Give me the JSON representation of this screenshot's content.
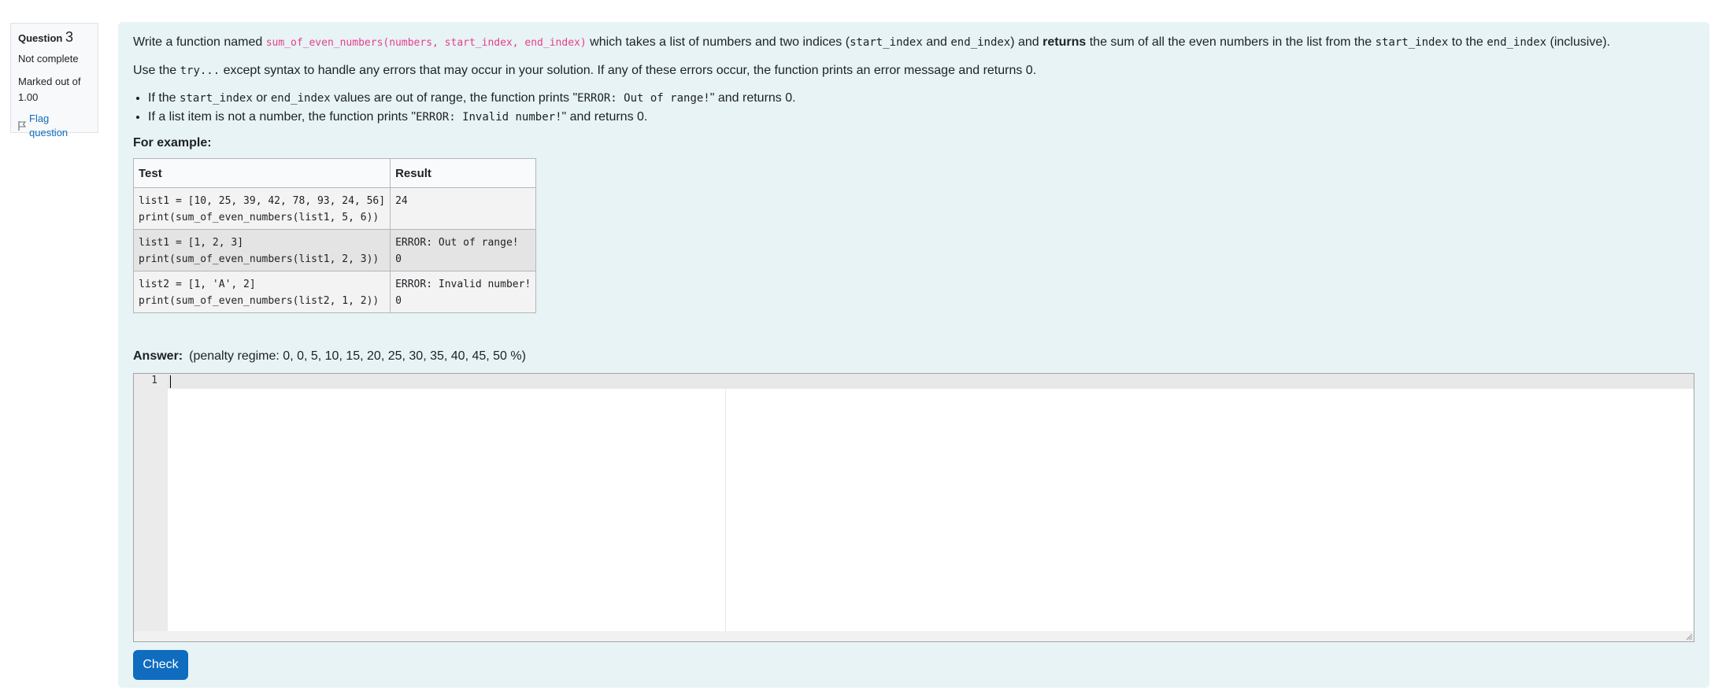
{
  "question": {
    "label": "Question",
    "number": "3",
    "state": "Not complete",
    "grade_line1": "Marked out of",
    "grade_line2": "1.00",
    "flag_label": "Flag question"
  },
  "content": {
    "intro_1": "Write a function named ",
    "func_sig": "sum_of_even_numbers(numbers, start_index, end_index)",
    "intro_2": " which takes a list of numbers and two indices (",
    "start_index": "start_index",
    "intro_and": " and ",
    "end_index": "end_index",
    "intro_3": ") and ",
    "returns_word": "returns",
    "intro_4": " the sum of all the even numbers in the list from the ",
    "intro_to": " to the ",
    "intro_5": " (inclusive).",
    "use_1": "Use the ",
    "try_code": "try...",
    "use_except": " except",
    "use_2": " syntax to handle any errors that may occur in your solution. If any of these errors occur, the function prints an error message and returns 0.",
    "bullets": [
      {
        "pre": "If the ",
        "c1": "start_index",
        "mid": " or ",
        "c2": "end_index",
        "post1": " values are out of range, the function prints \"",
        "msg": "ERROR: Out of range!",
        "post2": "\" and returns 0."
      },
      {
        "pre": "If a list item is not a number, the function prints \"",
        "msg": "ERROR: Invalid number!",
        "post2": "\" and returns 0."
      }
    ],
    "for_example": "For example:"
  },
  "examples": {
    "headers": [
      "Test",
      "Result"
    ],
    "rows": [
      {
        "test": "list1 = [10, 25, 39, 42, 78, 93, 24, 56]\nprint(sum_of_even_numbers(list1, 5, 6))",
        "result": "24"
      },
      {
        "test": "list1 = [1, 2, 3]\nprint(sum_of_even_numbers(list1, 2, 3))",
        "result": "ERROR: Out of range!\n0"
      },
      {
        "test": "list2 = [1, 'A', 2]\nprint(sum_of_even_numbers(list2, 1, 2))",
        "result": "ERROR: Invalid number!\n0"
      }
    ]
  },
  "answer": {
    "label": "Answer:",
    "penalty": "(penalty regime: 0, 0, 5, 10, 15, 20, 25, 30, 35, 40, 45, 50 %)",
    "line_number": "1",
    "code": ""
  },
  "check_label": "Check",
  "colors": {
    "panel_bg": "#e7f3f5",
    "accent": "#0f6cbf",
    "code_pink": "#e83e8c"
  }
}
